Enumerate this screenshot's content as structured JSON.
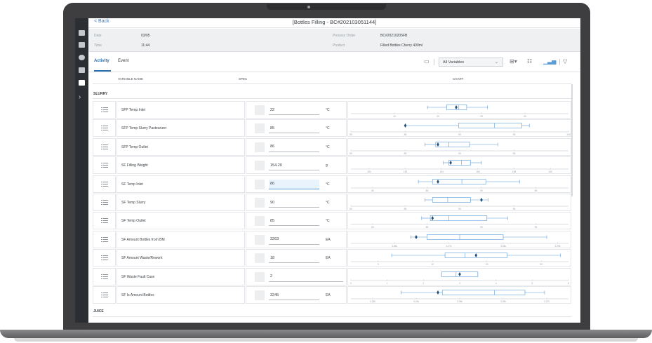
{
  "app": {
    "back_label": "< Back",
    "title": "[Bottles Filling - BC#202103051144]"
  },
  "info": {
    "date_label": "Date",
    "date_value": "03/05",
    "time_label": "Time",
    "time_value": "11:44",
    "process_order_label": "Process Order",
    "process_order_value": "BC#20210205FB",
    "product_label": "Product",
    "product_value": "Filled Bottles Cherry 400ml"
  },
  "tabs": [
    {
      "label": "Activity",
      "active": true
    },
    {
      "label": "Event",
      "active": false
    }
  ],
  "toolbar": {
    "variable_filter": "All Variables",
    "icons": [
      "comment-icon",
      "grid-view-icon",
      "list-view-icon",
      "chart-view-icon",
      "filter-icon"
    ]
  },
  "columns": {
    "variable_name": "VARIABLE NAME",
    "spec": "SPEC",
    "chart": "CHART"
  },
  "sections": [
    {
      "name": "SLURRY",
      "rows": [
        {
          "name": "SFP Temp Inlet",
          "value": "22",
          "unit": "°C",
          "chart": {
            "axis": [
              10,
              35
            ],
            "ticks": [
              "10",
              "20",
              "25",
              "30"
            ],
            "tick_values": [
              15,
              20,
              25,
              30
            ],
            "whisker_lo": 18.8,
            "q1": 21,
            "median": 22.4,
            "q3": 23.3,
            "whisker_hi": 25.7,
            "point": 22.1
          }
        },
        {
          "name": "SFP Temp Slurry Pasteurizer",
          "value": "85",
          "unit": "°C",
          "chart": {
            "axis": [
              80,
              100
            ],
            "ticks": [
              "80",
              "85",
              "90",
              "95",
              "100"
            ],
            "tick_values": [
              80,
              85,
              90,
              95,
              100
            ],
            "whisker_lo": 85,
            "q1": 89.9,
            "median": 93.2,
            "q3": 95.7,
            "whisker_hi": 96.4,
            "point": 85
          }
        },
        {
          "name": "SFP Temp Outlet",
          "value": "86",
          "unit": "°C",
          "chart": {
            "axis": [
              80,
              100
            ],
            "ticks": [
              "80",
              "85",
              "90",
              "95"
            ],
            "tick_values": [
              80,
              85,
              90,
              95
            ],
            "whisker_lo": 86.8,
            "q1": 87.8,
            "median": 89,
            "q3": 90.9,
            "whisker_hi": 93.5,
            "point": 88
          }
        },
        {
          "name": "SF Filling Weight",
          "value": "154.20",
          "unit": "g",
          "chart": {
            "axis": [
              149,
              161
            ],
            "ticks": [
              "150",
              "152",
              "154",
              "156",
              "158",
              "160"
            ],
            "tick_values": [
              150,
              152,
              154,
              156,
              158,
              160
            ],
            "whisker_lo": 154.1,
            "q1": 154.4,
            "median": 155.1,
            "q3": 155.6,
            "whisker_hi": 156.2,
            "point": 154.5
          }
        },
        {
          "name": "SF Temp Inlet",
          "value": "86",
          "unit": "°C",
          "chart": {
            "axis": [
              78,
              98
            ],
            "ticks": [
              "80",
              "85",
              "90",
              "95"
            ],
            "tick_values": [
              80,
              85,
              90,
              95
            ],
            "whisker_lo": 84.2,
            "q1": 85.5,
            "median": 88.2,
            "q3": 90.4,
            "whisker_hi": 93.5,
            "point": 86
          }
        },
        {
          "name": "SF Temp Slurry",
          "value": "90",
          "unit": "°C",
          "chart": {
            "axis": [
              80,
              100
            ],
            "ticks": [
              "80",
              "85",
              "90",
              "95"
            ],
            "tick_values": [
              80,
              85,
              90,
              95
            ],
            "whisker_lo": 86.8,
            "q1": 87.5,
            "median": 88.9,
            "q3": 91,
            "whisker_hi": 92.6,
            "point": 92
          }
        },
        {
          "name": "SF Temp Outlet",
          "value": "85",
          "unit": "°C",
          "chart": {
            "axis": [
              78,
              98
            ],
            "ticks": [
              "80",
              "85",
              "90",
              "95"
            ],
            "tick_values": [
              80,
              85,
              90,
              95
            ],
            "whisker_lo": 84.5,
            "q1": 85.3,
            "median": 87,
            "q3": 90.5,
            "whisker_hi": 92.4,
            "point": 85.5
          }
        },
        {
          "name": "SF Amount Bottles from BM",
          "value": "3263",
          "unit": "EA",
          "chart": {
            "axis": [
              3252,
              3292
            ],
            "ticks": [
              "3.26k",
              "3.27k",
              "3.28k",
              "3.29k"
            ],
            "tick_values": [
              3260,
              3270,
              3280,
              3290
            ],
            "whisker_lo": 3263,
            "q1": 3266,
            "median": 3272,
            "q3": 3280,
            "whisker_hi": 3288,
            "point": 3264
          }
        },
        {
          "name": "SF Amount Waste/Rework",
          "value": "18",
          "unit": "EA",
          "chart": {
            "axis": [
              -5,
              35
            ],
            "ticks": [
              "0",
              "10",
              "20",
              "30"
            ],
            "tick_values": [
              0,
              10,
              20,
              30
            ],
            "whisker_lo": 2.5,
            "q1": 12.3,
            "median": 16,
            "q3": 23.7,
            "whisker_hi": 33.5,
            "point": 18
          }
        },
        {
          "name": "SF Waste Fault Case",
          "value": "2",
          "unit": "",
          "chart": {
            "axis": [
              0,
              6
            ],
            "ticks": [
              "0",
              "1",
              "2",
              "3",
              "4",
              "5",
              "6"
            ],
            "tick_values": [
              0,
              1,
              2,
              3,
              4,
              5,
              6
            ],
            "whisker_lo": 2.5,
            "q1": 2.5,
            "median": 2.9,
            "q3": 3.5,
            "whisker_hi": 3.5,
            "point": 3
          }
        },
        {
          "name": "SF Is Amount Bottles",
          "value": "3245",
          "unit": "EA",
          "chart": {
            "axis": [
              3225,
              3275
            ],
            "ticks": [
              "3.23k",
              "3.24k",
              "3.25k",
              "3.26k",
              "3.27k"
            ],
            "tick_values": [
              3230,
              3240,
              3250,
              3260,
              3270
            ],
            "whisker_lo": 3236.5,
            "q1": 3246,
            "median": 3258,
            "q3": 3265,
            "whisker_hi": 3269.5,
            "point": 3245
          }
        }
      ]
    },
    {
      "name": "JUICE",
      "rows": []
    }
  ],
  "colors": {
    "accent": "#2a6fb0",
    "box_stroke": "#5b9bd5",
    "marker": "#1f4f7a",
    "sidebar": "#2b2f33"
  }
}
